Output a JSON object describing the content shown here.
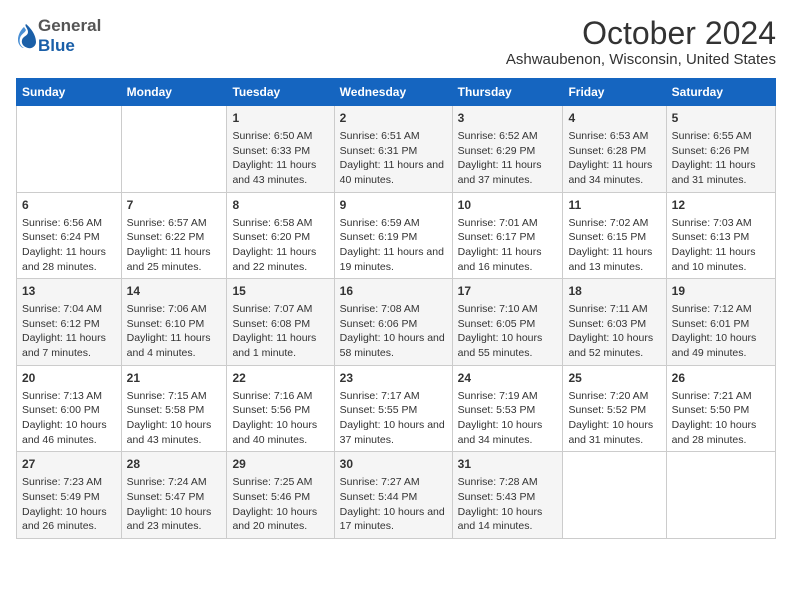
{
  "header": {
    "logo_general": "General",
    "logo_blue": "Blue",
    "title": "October 2024",
    "subtitle": "Ashwaubenon, Wisconsin, United States"
  },
  "days_of_week": [
    "Sunday",
    "Monday",
    "Tuesday",
    "Wednesday",
    "Thursday",
    "Friday",
    "Saturday"
  ],
  "weeks": [
    [
      {
        "day": "",
        "info": ""
      },
      {
        "day": "",
        "info": ""
      },
      {
        "day": "1",
        "sunrise": "Sunrise: 6:50 AM",
        "sunset": "Sunset: 6:33 PM",
        "daylight": "Daylight: 11 hours and 43 minutes."
      },
      {
        "day": "2",
        "sunrise": "Sunrise: 6:51 AM",
        "sunset": "Sunset: 6:31 PM",
        "daylight": "Daylight: 11 hours and 40 minutes."
      },
      {
        "day": "3",
        "sunrise": "Sunrise: 6:52 AM",
        "sunset": "Sunset: 6:29 PM",
        "daylight": "Daylight: 11 hours and 37 minutes."
      },
      {
        "day": "4",
        "sunrise": "Sunrise: 6:53 AM",
        "sunset": "Sunset: 6:28 PM",
        "daylight": "Daylight: 11 hours and 34 minutes."
      },
      {
        "day": "5",
        "sunrise": "Sunrise: 6:55 AM",
        "sunset": "Sunset: 6:26 PM",
        "daylight": "Daylight: 11 hours and 31 minutes."
      }
    ],
    [
      {
        "day": "6",
        "sunrise": "Sunrise: 6:56 AM",
        "sunset": "Sunset: 6:24 PM",
        "daylight": "Daylight: 11 hours and 28 minutes."
      },
      {
        "day": "7",
        "sunrise": "Sunrise: 6:57 AM",
        "sunset": "Sunset: 6:22 PM",
        "daylight": "Daylight: 11 hours and 25 minutes."
      },
      {
        "day": "8",
        "sunrise": "Sunrise: 6:58 AM",
        "sunset": "Sunset: 6:20 PM",
        "daylight": "Daylight: 11 hours and 22 minutes."
      },
      {
        "day": "9",
        "sunrise": "Sunrise: 6:59 AM",
        "sunset": "Sunset: 6:19 PM",
        "daylight": "Daylight: 11 hours and 19 minutes."
      },
      {
        "day": "10",
        "sunrise": "Sunrise: 7:01 AM",
        "sunset": "Sunset: 6:17 PM",
        "daylight": "Daylight: 11 hours and 16 minutes."
      },
      {
        "day": "11",
        "sunrise": "Sunrise: 7:02 AM",
        "sunset": "Sunset: 6:15 PM",
        "daylight": "Daylight: 11 hours and 13 minutes."
      },
      {
        "day": "12",
        "sunrise": "Sunrise: 7:03 AM",
        "sunset": "Sunset: 6:13 PM",
        "daylight": "Daylight: 11 hours and 10 minutes."
      }
    ],
    [
      {
        "day": "13",
        "sunrise": "Sunrise: 7:04 AM",
        "sunset": "Sunset: 6:12 PM",
        "daylight": "Daylight: 11 hours and 7 minutes."
      },
      {
        "day": "14",
        "sunrise": "Sunrise: 7:06 AM",
        "sunset": "Sunset: 6:10 PM",
        "daylight": "Daylight: 11 hours and 4 minutes."
      },
      {
        "day": "15",
        "sunrise": "Sunrise: 7:07 AM",
        "sunset": "Sunset: 6:08 PM",
        "daylight": "Daylight: 11 hours and 1 minute."
      },
      {
        "day": "16",
        "sunrise": "Sunrise: 7:08 AM",
        "sunset": "Sunset: 6:06 PM",
        "daylight": "Daylight: 10 hours and 58 minutes."
      },
      {
        "day": "17",
        "sunrise": "Sunrise: 7:10 AM",
        "sunset": "Sunset: 6:05 PM",
        "daylight": "Daylight: 10 hours and 55 minutes."
      },
      {
        "day": "18",
        "sunrise": "Sunrise: 7:11 AM",
        "sunset": "Sunset: 6:03 PM",
        "daylight": "Daylight: 10 hours and 52 minutes."
      },
      {
        "day": "19",
        "sunrise": "Sunrise: 7:12 AM",
        "sunset": "Sunset: 6:01 PM",
        "daylight": "Daylight: 10 hours and 49 minutes."
      }
    ],
    [
      {
        "day": "20",
        "sunrise": "Sunrise: 7:13 AM",
        "sunset": "Sunset: 6:00 PM",
        "daylight": "Daylight: 10 hours and 46 minutes."
      },
      {
        "day": "21",
        "sunrise": "Sunrise: 7:15 AM",
        "sunset": "Sunset: 5:58 PM",
        "daylight": "Daylight: 10 hours and 43 minutes."
      },
      {
        "day": "22",
        "sunrise": "Sunrise: 7:16 AM",
        "sunset": "Sunset: 5:56 PM",
        "daylight": "Daylight: 10 hours and 40 minutes."
      },
      {
        "day": "23",
        "sunrise": "Sunrise: 7:17 AM",
        "sunset": "Sunset: 5:55 PM",
        "daylight": "Daylight: 10 hours and 37 minutes."
      },
      {
        "day": "24",
        "sunrise": "Sunrise: 7:19 AM",
        "sunset": "Sunset: 5:53 PM",
        "daylight": "Daylight: 10 hours and 34 minutes."
      },
      {
        "day": "25",
        "sunrise": "Sunrise: 7:20 AM",
        "sunset": "Sunset: 5:52 PM",
        "daylight": "Daylight: 10 hours and 31 minutes."
      },
      {
        "day": "26",
        "sunrise": "Sunrise: 7:21 AM",
        "sunset": "Sunset: 5:50 PM",
        "daylight": "Daylight: 10 hours and 28 minutes."
      }
    ],
    [
      {
        "day": "27",
        "sunrise": "Sunrise: 7:23 AM",
        "sunset": "Sunset: 5:49 PM",
        "daylight": "Daylight: 10 hours and 26 minutes."
      },
      {
        "day": "28",
        "sunrise": "Sunrise: 7:24 AM",
        "sunset": "Sunset: 5:47 PM",
        "daylight": "Daylight: 10 hours and 23 minutes."
      },
      {
        "day": "29",
        "sunrise": "Sunrise: 7:25 AM",
        "sunset": "Sunset: 5:46 PM",
        "daylight": "Daylight: 10 hours and 20 minutes."
      },
      {
        "day": "30",
        "sunrise": "Sunrise: 7:27 AM",
        "sunset": "Sunset: 5:44 PM",
        "daylight": "Daylight: 10 hours and 17 minutes."
      },
      {
        "day": "31",
        "sunrise": "Sunrise: 7:28 AM",
        "sunset": "Sunset: 5:43 PM",
        "daylight": "Daylight: 10 hours and 14 minutes."
      },
      {
        "day": "",
        "info": ""
      },
      {
        "day": "",
        "info": ""
      }
    ]
  ]
}
